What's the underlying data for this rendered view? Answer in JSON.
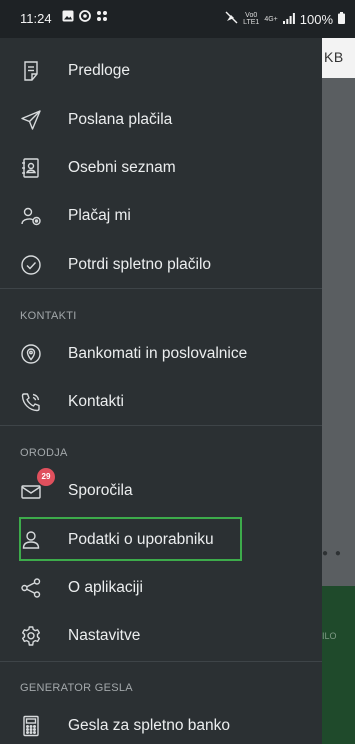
{
  "status_bar": {
    "time": "11:24",
    "network_top": "Vo0",
    "network_bottom": "LTE1",
    "signal_type": "4G+",
    "battery": "100%"
  },
  "app_background": {
    "header_text": "KB",
    "bottom_button_text": "ILO"
  },
  "drawer": {
    "items_top": [
      {
        "label": "Predloge",
        "icon": "template-icon"
      },
      {
        "label": "Poslana plačila",
        "icon": "send-icon"
      },
      {
        "label": "Osebni seznam",
        "icon": "contacts-book-icon"
      },
      {
        "label": "Plačaj mi",
        "icon": "request-payment-icon"
      },
      {
        "label": "Potrdi spletno plačilo",
        "icon": "check-circle-icon"
      }
    ],
    "sections": [
      {
        "title": "KONTAKTI",
        "items": [
          {
            "label": "Bankomati in poslovalnice",
            "icon": "location-pin-icon"
          },
          {
            "label": "Kontakti",
            "icon": "phone-icon"
          }
        ]
      },
      {
        "title": "ORODJA",
        "items": [
          {
            "label": "Sporočila",
            "icon": "mail-icon",
            "badge": "29"
          },
          {
            "label": "Podatki o uporabniku",
            "icon": "user-icon"
          },
          {
            "label": "O aplikaciji",
            "icon": "share-icon"
          },
          {
            "label": "Nastavitve",
            "icon": "gear-icon"
          }
        ]
      },
      {
        "title": "GENERATOR GESLA",
        "items": [
          {
            "label": "Gesla za spletno banko",
            "icon": "calculator-icon"
          }
        ]
      }
    ]
  },
  "colors": {
    "drawer_bg": "#2b3033",
    "highlight": "#3dab4b",
    "badge": "#e0505d"
  }
}
